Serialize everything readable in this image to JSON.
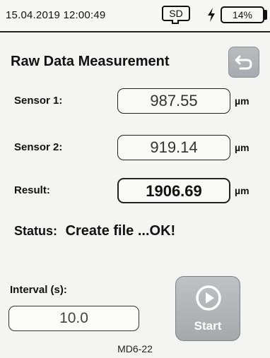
{
  "statusbar": {
    "datetime": "15.04.2019 12:00:49",
    "sd_label": "SD",
    "battery_percent": "14%",
    "battery_level": 0.14,
    "charging_icon": "lightning-bolt-icon"
  },
  "header": {
    "title": "Raw Data Measurement",
    "back_icon": "back-arrow-icon"
  },
  "measurements": [
    {
      "label": "Sensor 1:",
      "value": "987.55",
      "unit": "µm"
    },
    {
      "label": "Sensor 2:",
      "value": "919.14",
      "unit": "µm"
    },
    {
      "label": "Result:",
      "value": "1906.69",
      "unit": "µm"
    }
  ],
  "status": {
    "label": "Status:",
    "value": "Create file ...OK!"
  },
  "interval": {
    "label": "Interval (s):",
    "value": "10.0"
  },
  "start_button": {
    "label": "Start",
    "icon": "play-circle-icon"
  },
  "footer": {
    "device_id": "MD6-22"
  }
}
